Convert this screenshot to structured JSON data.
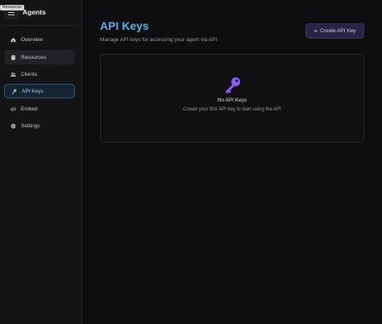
{
  "app": {
    "name": "Agents",
    "tooltip": "Resources"
  },
  "sidebar": {
    "items": [
      {
        "label": "Overview",
        "icon": "home-icon",
        "state": "normal"
      },
      {
        "label": "Resources",
        "icon": "database-icon",
        "state": "hover"
      },
      {
        "label": "Clients",
        "icon": "users-icon",
        "state": "normal"
      },
      {
        "label": "API Keys",
        "icon": "key-icon",
        "state": "active"
      },
      {
        "label": "Embed",
        "icon": "code-icon",
        "state": "normal"
      },
      {
        "label": "Settings",
        "icon": "gear-icon",
        "state": "normal"
      }
    ]
  },
  "page": {
    "title": "API Keys",
    "subtitle": "Manage API keys for accessing your agent via API",
    "create_button": "Create API Key"
  },
  "empty_state": {
    "title": "No API Keys",
    "text": "Create your first API key to start using the API",
    "icon": "key-icon"
  },
  "colors": {
    "accent": "#5eb0ea",
    "key_icon": "#8b5cf6",
    "button_bg": "#2a2342"
  }
}
